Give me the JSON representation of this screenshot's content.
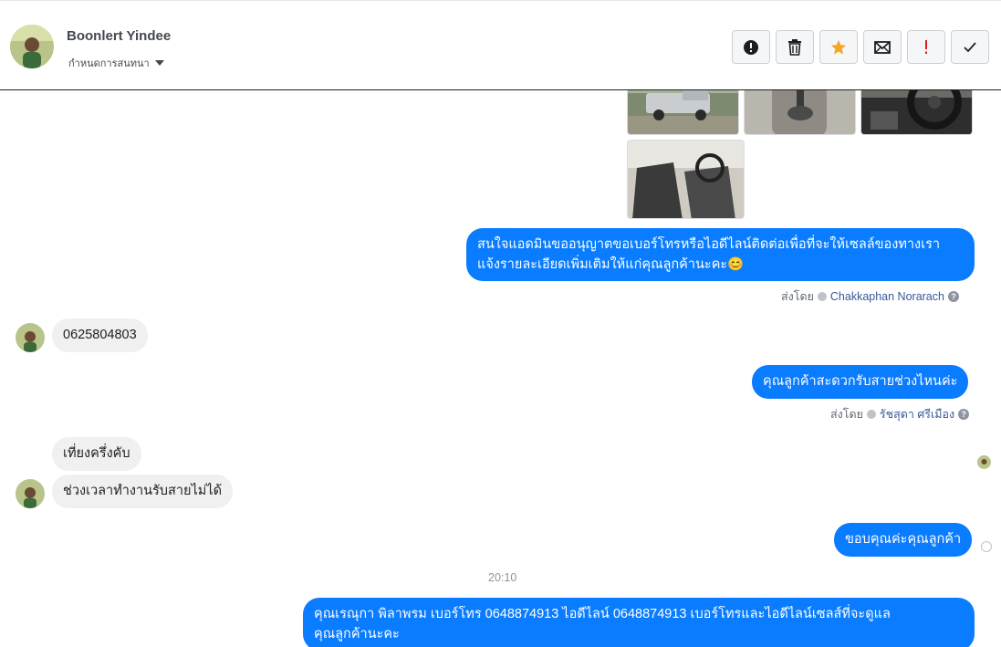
{
  "header": {
    "name": "Boonlert Yindee",
    "subtitle": "กำหนดการสนทนา",
    "actions": [
      {
        "icon": "alert-circle-icon",
        "color": "#1c1e21"
      },
      {
        "icon": "trash-icon",
        "color": "#1c1e21"
      },
      {
        "icon": "star-icon",
        "color": "#f5a623"
      },
      {
        "icon": "envelope-icon",
        "color": "#1c1e21"
      },
      {
        "icon": "exclamation-icon",
        "color": "#e02020"
      },
      {
        "icon": "check-icon",
        "color": "#1c1e21"
      }
    ]
  },
  "messages": {
    "m1": "สนใจแอดมินขออนุญาตขอเบอร์โทรหรือไอดีไลน์ติดต่อเพื่อที่จะให้เซลล์ของทางเรา\nแจ้งรายละเอียดเพิ่มเติมให้แก่คุณลูกค้านะคะ😊",
    "m1_sent_label": "ส่งโดย",
    "m1_sender": "Chakkaphan Norarach",
    "m2": "0625804803",
    "m3": "คุณลูกค้าสะดวกรับสายช่วงไหนค่ะ",
    "m3_sent_label": "ส่งโดย",
    "m3_sender": "รัชสุดา ศรีเมือง",
    "m4": "เที่ยงครึ่งคับ",
    "m5": "ช่วงเวลาทำงานรับสายไม่ได้",
    "m6": "ขอบคุณค่ะคุณลูกค้า",
    "time": "20:10",
    "m7": "คุณเรณุกา พิลาพรม        เบอร์โทร 0648874913  ไอดีไลน์ 0648874913   เบอร์โทรและไอดีไลน์เซลส์ที่จะดูแล\nคุณลูกค้านะคะ"
  },
  "colors": {
    "outgoing_bubble": "#0a7cff",
    "incoming_bubble": "#f0f0f0"
  }
}
